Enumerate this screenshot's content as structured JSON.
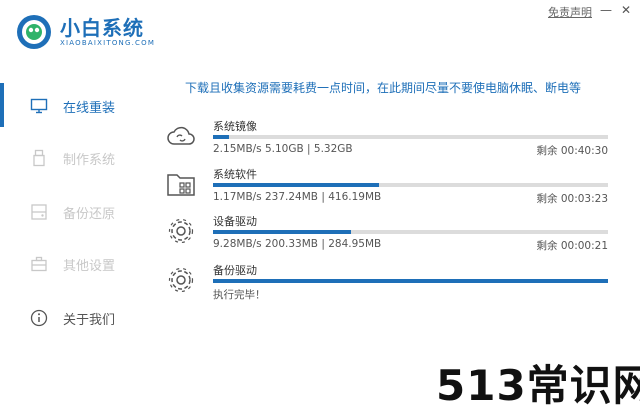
{
  "header": {
    "title": "小白系统",
    "subtitle": "XIAOBAIXITONG.COM",
    "disclaimer": "免责声明",
    "min_glyph": "—",
    "close_glyph": "✕",
    "brand_color": "#1e6fb8"
  },
  "sidebar": {
    "items": [
      {
        "label": "在线重装",
        "icon": "monitor-icon",
        "state": "active"
      },
      {
        "label": "制作系统",
        "icon": "usb-icon",
        "state": "disabled"
      },
      {
        "label": "备份还原",
        "icon": "backup-icon",
        "state": "disabled"
      },
      {
        "label": "其他设置",
        "icon": "toolbox-icon",
        "state": "disabled"
      },
      {
        "label": "关于我们",
        "icon": "info-icon",
        "state": "normal"
      }
    ]
  },
  "main": {
    "notice": "下载且收集资源需要耗费一点时间，在此期间尽量不要使电脑休眠、断电等",
    "tasks": [
      {
        "name": "系统镜像",
        "icon": "cloud-icon",
        "progress": 0.04,
        "stats": "2.15MB/s 5.10GB | 5.32GB",
        "remaining": "剩余 00:40:30"
      },
      {
        "name": "系统软件",
        "icon": "folder-apps-icon",
        "progress": 0.42,
        "stats": "1.17MB/s 237.24MB | 416.19MB",
        "remaining": "剩余 00:03:23"
      },
      {
        "name": "设备驱动",
        "icon": "gear-icon",
        "progress": 0.35,
        "stats": "9.28MB/s 200.33MB | 284.95MB",
        "remaining": "剩余 00:00:21"
      },
      {
        "name": "备份驱动",
        "icon": "gear-icon",
        "progress": 1.0,
        "stats": "执行完毕！",
        "remaining": ""
      }
    ]
  },
  "watermark": "513常识网"
}
